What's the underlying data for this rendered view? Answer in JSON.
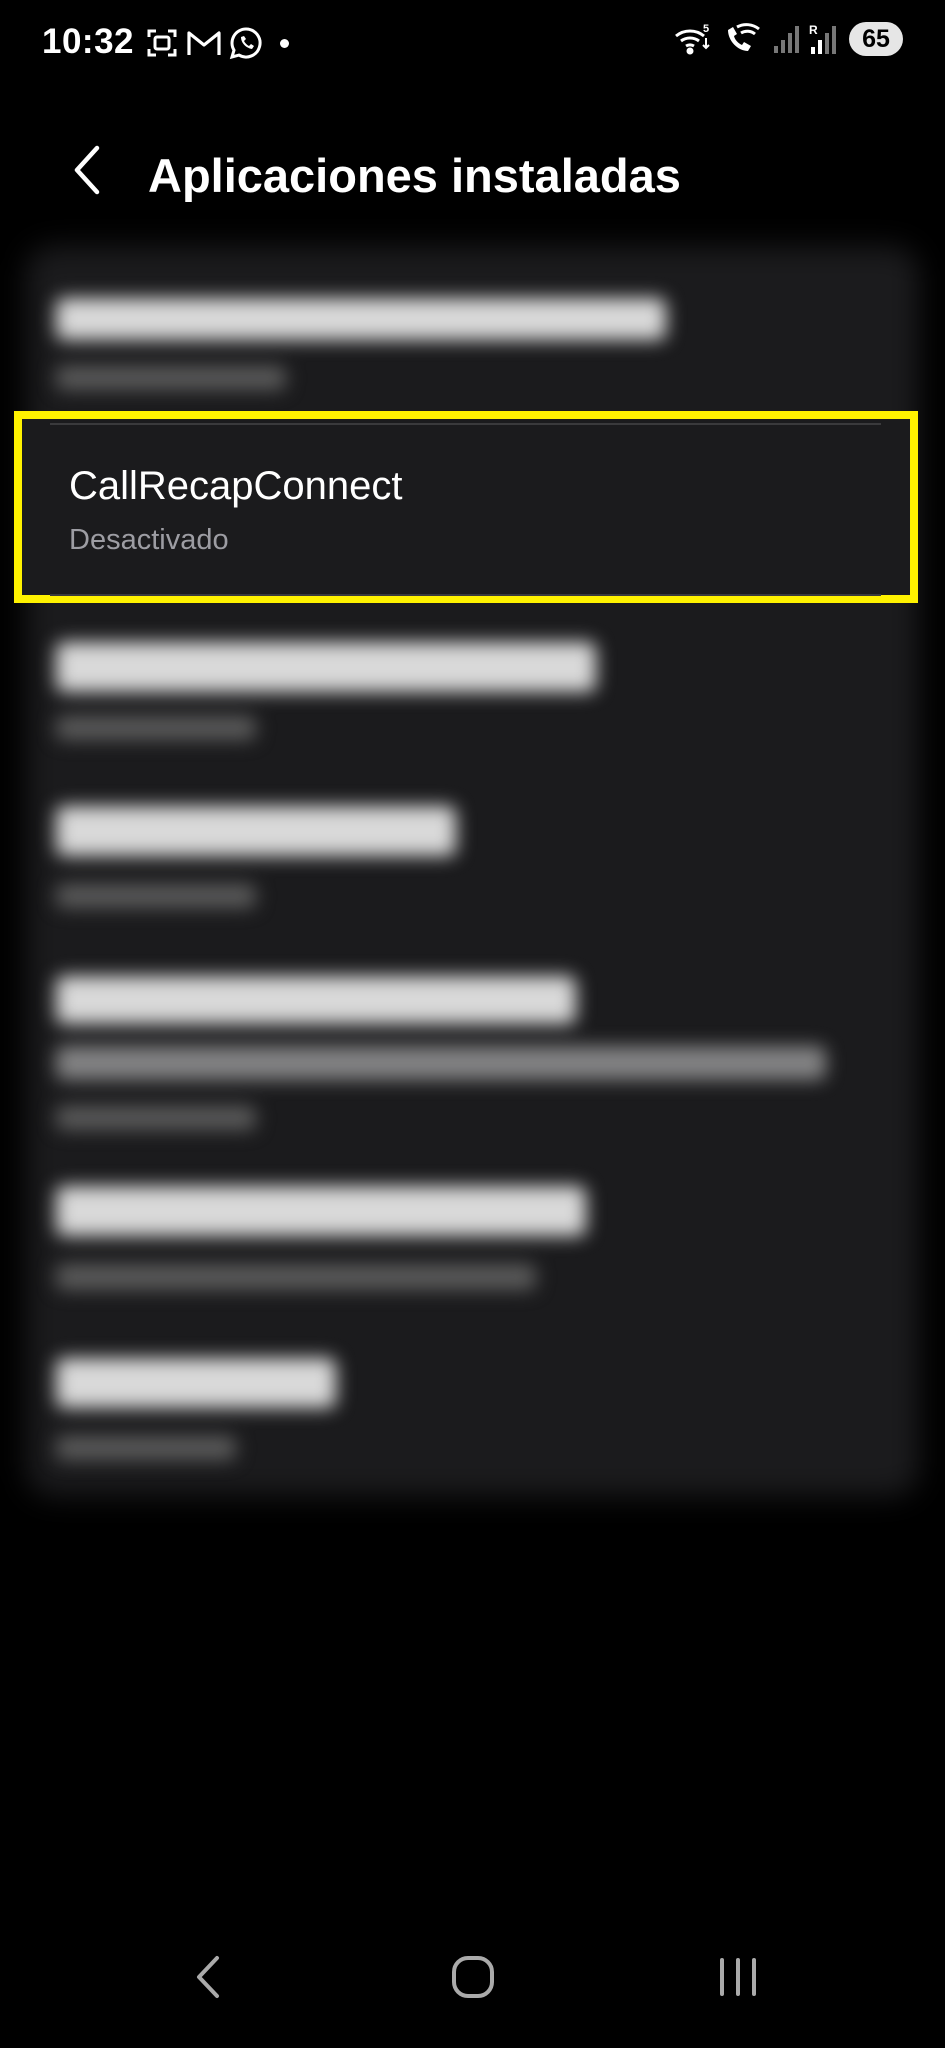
{
  "status_bar": {
    "time": "10:32",
    "left_icons": [
      "screenshot-icon",
      "gmail-icon",
      "whatsapp-icon",
      "notification-dot"
    ],
    "right_icons": [
      "wifi-5-icon",
      "wifi-call-icon",
      "signal-icon",
      "signal-roaming-icon"
    ],
    "battery_level": "65"
  },
  "header": {
    "back_icon": "chevron-left-icon",
    "title": "Aplicaciones instaladas"
  },
  "highlighted_app": {
    "name": "CallRecapConnect",
    "status": "Desactivado",
    "highlight_color": "#fff200"
  },
  "colors": {
    "background": "#000000",
    "card": "#1b1b1d",
    "secondary_text": "#9d9da3"
  },
  "nav_bar": {
    "buttons": [
      "back-nav-icon",
      "home-nav-icon",
      "recents-nav-icon"
    ]
  }
}
